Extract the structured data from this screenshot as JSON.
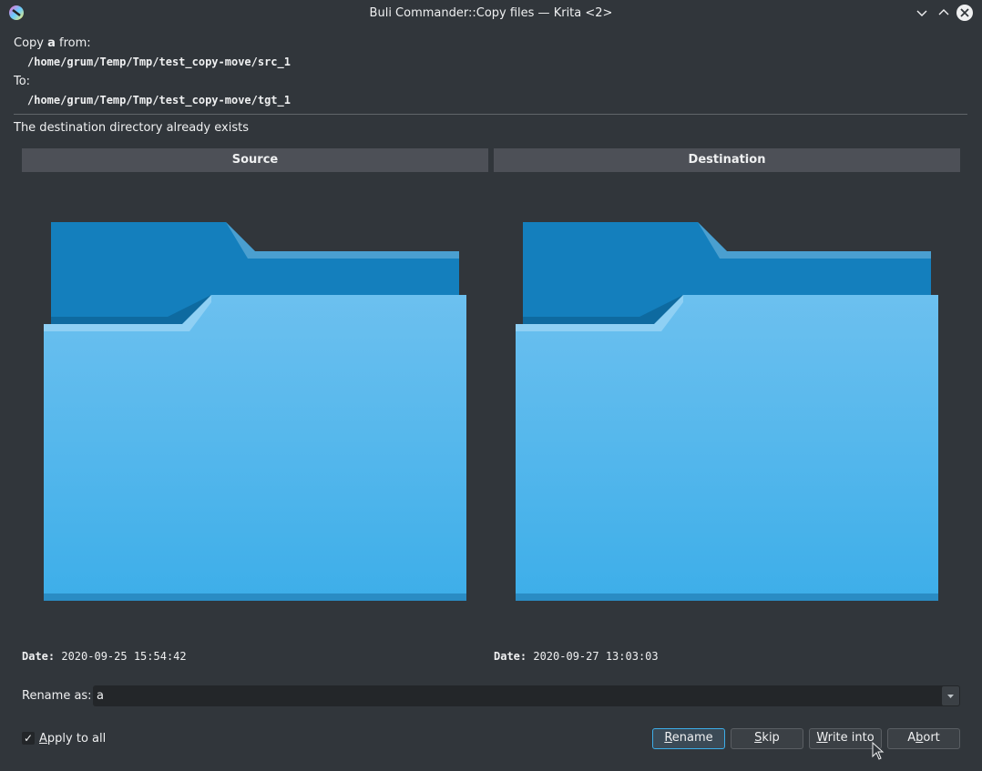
{
  "window": {
    "title": "Buli Commander::Copy files — Krita <2>"
  },
  "header": {
    "copy_prefix": "Copy ",
    "copy_name": "a",
    "copy_suffix": " from:",
    "source_path": "/home/grum/Temp/Tmp/test_copy-move/src_1",
    "to_label": "To:",
    "target_path": "/home/grum/Temp/Tmp/test_copy-move/tgt_1"
  },
  "message": "The destination directory already exists",
  "source": {
    "header": "Source",
    "date_label": "Date:",
    "date": "2020-09-25 15:54:42"
  },
  "destination": {
    "header": "Destination",
    "date_label": "Date:",
    "date": "2020-09-27 13:03:03"
  },
  "rename": {
    "label": "Rename as:",
    "value": "a"
  },
  "apply_all": {
    "label_u": "A",
    "label_rest": "pply to all",
    "checked": true
  },
  "buttons": {
    "rename": {
      "u": "R",
      "rest": "ename"
    },
    "skip": {
      "u": "S",
      "rest": "kip"
    },
    "write_into": {
      "u": "W",
      "rest": "rite into"
    },
    "abort": {
      "pre": "A",
      "u": "b",
      "rest": "ort"
    }
  },
  "colors": {
    "accent": "#3daee9",
    "folder_light": "#6cc0ef",
    "folder_dark": "#147fbd"
  }
}
